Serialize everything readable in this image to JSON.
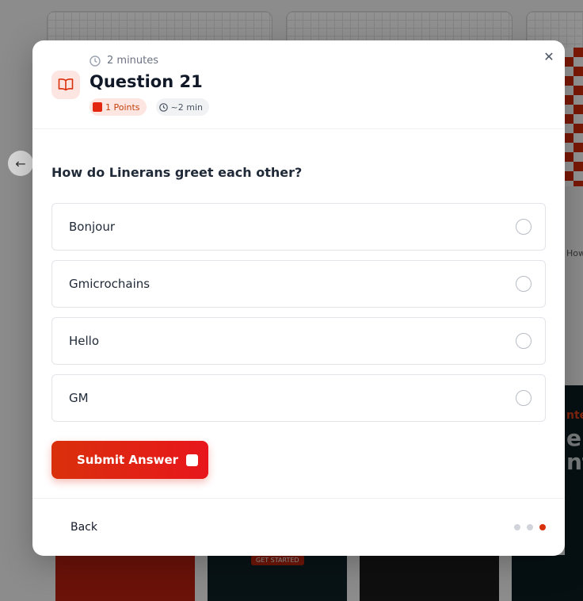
{
  "background": {
    "partial_text": "How",
    "dark_card_text_top": "nte",
    "dark_card_text_mid": "e",
    "dark_card_text_low": "nt",
    "thumb_text": "GET STARTED"
  },
  "modal": {
    "duration": "2 minutes",
    "title": "Question 21",
    "points_badge": "1 Points",
    "time_badge": "~2 min",
    "question": "How do Linerans greet each other?",
    "options": [
      {
        "label": "Bonjour"
      },
      {
        "label": "Gmicrochains"
      },
      {
        "label": "Hello"
      },
      {
        "label": "GM"
      }
    ],
    "submit_label": "Submit Answer",
    "back_label": "Back",
    "progress": {
      "total_steps": 3,
      "current_step": 3
    }
  },
  "colors": {
    "accent": "#e2260f",
    "accent_light": "#fde5e1",
    "text": "#111827",
    "muted": "#6b7280"
  },
  "icons": [
    "clock-icon",
    "book-icon",
    "close-icon",
    "arrow-left-icon"
  ]
}
